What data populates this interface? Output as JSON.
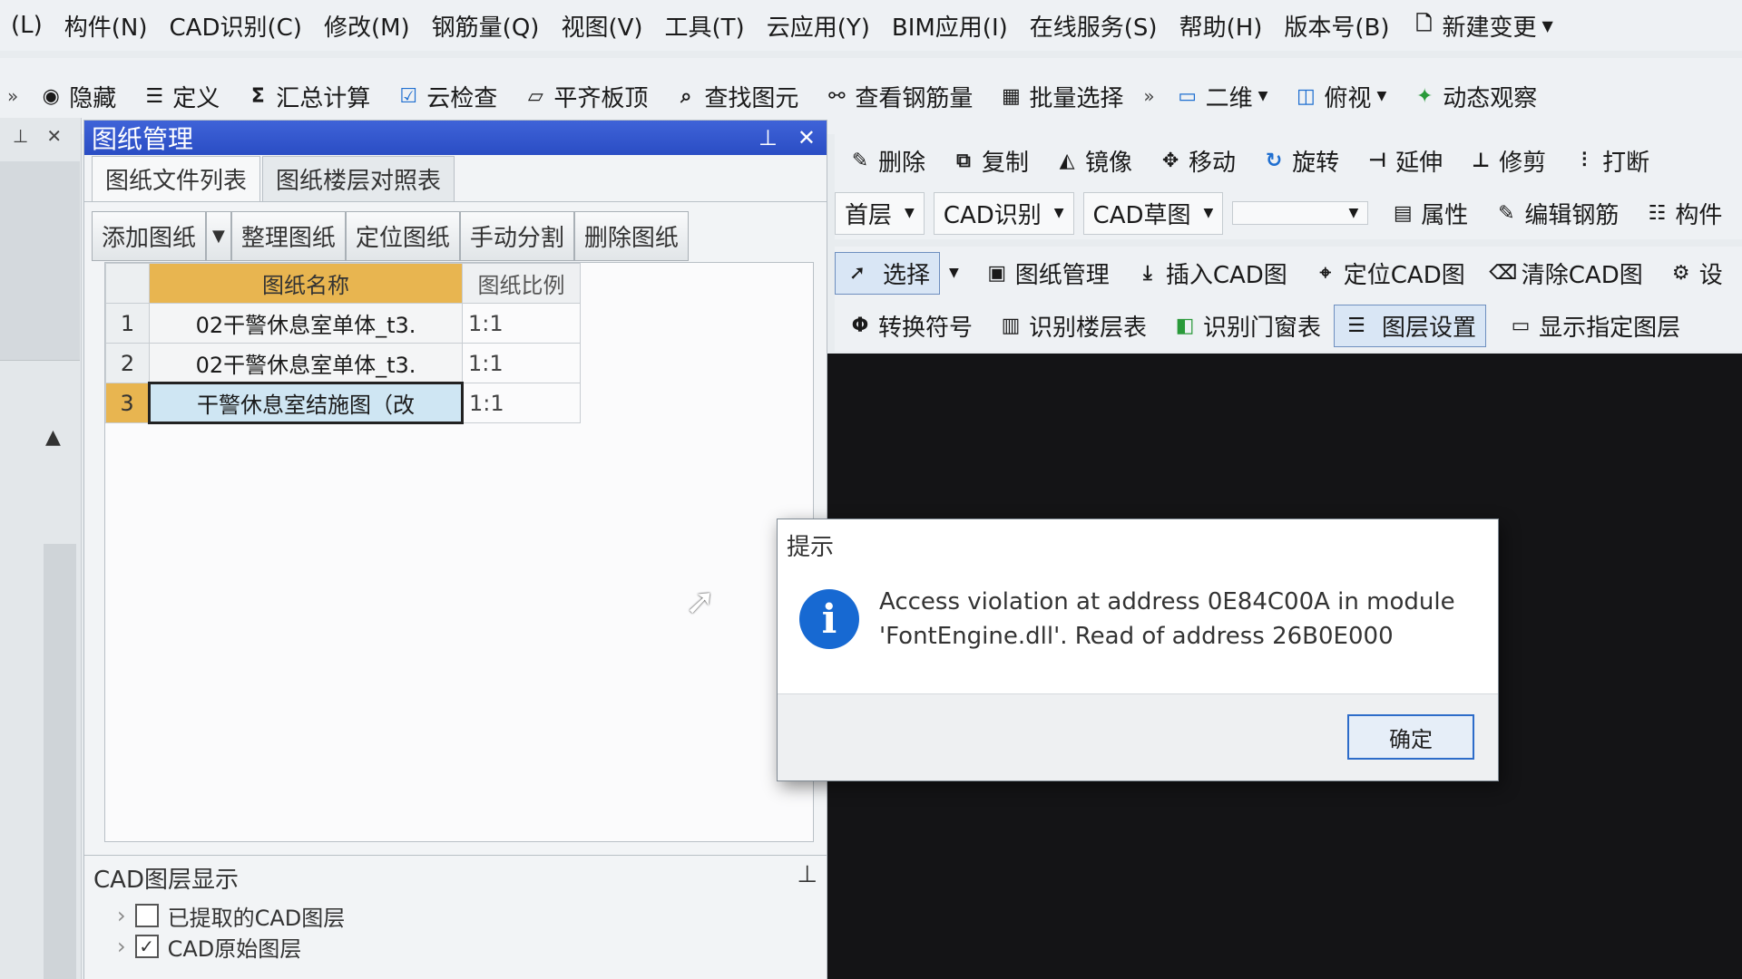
{
  "menubar": {
    "items": [
      "(L)",
      "构件(N)",
      "CAD识别(C)",
      "修改(M)",
      "钢筋量(Q)",
      "视图(V)",
      "工具(T)",
      "云应用(Y)",
      "BIM应用(I)",
      "在线服务(S)",
      "帮助(H)",
      "版本号(B)"
    ],
    "new_change": "新建变更"
  },
  "toolbar": {
    "hide": "隐藏",
    "define": "定义",
    "summary": "汇总计算",
    "cloud_check": "云检查",
    "align_top": "平齐板顶",
    "find": "查找图元",
    "view_rebar": "查看钢筋量",
    "batch_select": "批量选择",
    "view_2d": "二维",
    "top_view": "俯视",
    "dynamic": "动态观察"
  },
  "panel": {
    "title": "图纸管理",
    "tabs": [
      "图纸文件列表",
      "图纸楼层对照表"
    ],
    "buttons": [
      "添加图纸",
      "整理图纸",
      "定位图纸",
      "手动分割",
      "删除图纸"
    ],
    "columns": [
      "图纸名称",
      "图纸比例"
    ],
    "rows": [
      {
        "num": "1",
        "name": "02干警休息室单体_t3.",
        "scale": "1:1"
      },
      {
        "num": "2",
        "name": "02干警休息室单体_t3.",
        "scale": "1:1"
      },
      {
        "num": "3",
        "name": "干警休息室结施图（改",
        "scale": "1:1"
      }
    ]
  },
  "layers": {
    "title": "CAD图层显示",
    "items": [
      {
        "label": "已提取的CAD图层",
        "checked": false
      },
      {
        "label": "CAD原始图层",
        "checked": true
      }
    ]
  },
  "right_toolbar": {
    "row1": [
      "删除",
      "复制",
      "镜像",
      "移动",
      "旋转",
      "延伸",
      "修剪",
      "打断"
    ],
    "row2": {
      "floor": "首层",
      "mode": "CAD识别",
      "draft": "CAD草图",
      "props": "属性",
      "edit_rebar": "编辑钢筋",
      "component": "构件"
    },
    "row3": [
      "选择",
      "图纸管理",
      "插入CAD图",
      "定位CAD图",
      "清除CAD图",
      "设"
    ],
    "row4": [
      "转换符号",
      "识别楼层表",
      "识别门窗表",
      "图层设置",
      "显示指定图层"
    ]
  },
  "dialog": {
    "title": "提示",
    "message_line1": "Access violation at address 0E84C00A in module",
    "message_line2": "'FontEngine.dll'. Read of address 26B0E000",
    "ok": "确定"
  }
}
